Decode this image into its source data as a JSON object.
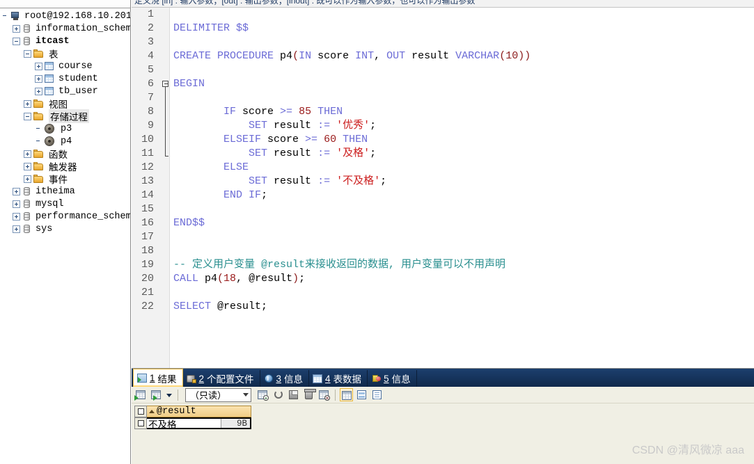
{
  "sidebar": {
    "root_label": "root@192.168.10.201",
    "nodes": [
      {
        "label": "root@192.168.10.201",
        "icon": "server-icon",
        "indent": 0,
        "expander": "none",
        "bold": false,
        "selected": false,
        "cjk": false
      },
      {
        "label": "information_schema",
        "icon": "database-icon",
        "indent": 1,
        "expander": "plus",
        "bold": false,
        "selected": false,
        "cjk": false
      },
      {
        "label": "itcast",
        "icon": "database-icon",
        "indent": 1,
        "expander": "minus",
        "bold": true,
        "selected": false,
        "cjk": false
      },
      {
        "label": "表",
        "icon": "folder-icon",
        "indent": 2,
        "expander": "minus",
        "bold": false,
        "selected": false,
        "cjk": true
      },
      {
        "label": "course",
        "icon": "table-icon",
        "indent": 3,
        "expander": "plus",
        "bold": false,
        "selected": false,
        "cjk": false
      },
      {
        "label": "student",
        "icon": "table-icon",
        "indent": 3,
        "expander": "plus",
        "bold": false,
        "selected": false,
        "cjk": false
      },
      {
        "label": "tb_user",
        "icon": "table-icon",
        "indent": 3,
        "expander": "plus",
        "bold": false,
        "selected": false,
        "cjk": false
      },
      {
        "label": "视图",
        "icon": "folder-icon",
        "indent": 2,
        "expander": "plus",
        "bold": false,
        "selected": false,
        "cjk": true
      },
      {
        "label": "存储过程",
        "icon": "folder-icon",
        "indent": 2,
        "expander": "minus",
        "bold": false,
        "selected": true,
        "cjk": true
      },
      {
        "label": "p3",
        "icon": "procedure-icon",
        "indent": 3,
        "expander": "none",
        "bold": false,
        "selected": false,
        "cjk": false
      },
      {
        "label": "p4",
        "icon": "procedure-icon",
        "indent": 3,
        "expander": "none",
        "bold": false,
        "selected": false,
        "cjk": false
      },
      {
        "label": "函数",
        "icon": "folder-icon",
        "indent": 2,
        "expander": "plus",
        "bold": false,
        "selected": false,
        "cjk": true
      },
      {
        "label": "触发器",
        "icon": "folder-icon",
        "indent": 2,
        "expander": "plus",
        "bold": false,
        "selected": false,
        "cjk": true
      },
      {
        "label": "事件",
        "icon": "folder-icon",
        "indent": 2,
        "expander": "plus",
        "bold": false,
        "selected": false,
        "cjk": true
      },
      {
        "label": "itheima",
        "icon": "database-icon",
        "indent": 1,
        "expander": "plus",
        "bold": false,
        "selected": false,
        "cjk": false
      },
      {
        "label": "mysql",
        "icon": "database-icon",
        "indent": 1,
        "expander": "plus",
        "bold": false,
        "selected": false,
        "cjk": false
      },
      {
        "label": "performance_schema",
        "icon": "database-icon",
        "indent": 1,
        "expander": "plus",
        "bold": false,
        "selected": false,
        "cjk": false
      },
      {
        "label": "sys",
        "icon": "database-icon",
        "indent": 1,
        "expander": "plus",
        "bold": false,
        "selected": false,
        "cjk": false
      }
    ]
  },
  "editor": {
    "clipped_top_text": "定义浇 [in] : 输入参数；[out] : 输出参数；[inout] : 既可以作为输入参数，也可以作为输出参数",
    "lines": [
      {
        "n": 1,
        "indent": 0,
        "tokens": []
      },
      {
        "n": 2,
        "indent": 0,
        "tokens": [
          {
            "t": "kw",
            "s": "DELIMITER"
          },
          {
            "t": "id",
            "s": " "
          },
          {
            "t": "kw",
            "s": "$$"
          }
        ]
      },
      {
        "n": 3,
        "indent": 0,
        "tokens": []
      },
      {
        "n": 4,
        "indent": 0,
        "tokens": [
          {
            "t": "kw",
            "s": "CREATE"
          },
          {
            "t": "id",
            "s": " "
          },
          {
            "t": "kw",
            "s": "PROCEDURE"
          },
          {
            "t": "id",
            "s": " p4"
          },
          {
            "t": "par",
            "s": "("
          },
          {
            "t": "kw",
            "s": "IN"
          },
          {
            "t": "id",
            "s": " score "
          },
          {
            "t": "kw",
            "s": "INT"
          },
          {
            "t": "pun",
            "s": ", "
          },
          {
            "t": "kw",
            "s": "OUT"
          },
          {
            "t": "id",
            "s": " result "
          },
          {
            "t": "kw",
            "s": "VARCHAR"
          },
          {
            "t": "par",
            "s": "(10))"
          }
        ]
      },
      {
        "n": 5,
        "indent": 0,
        "tokens": []
      },
      {
        "n": 6,
        "indent": 0,
        "tokens": [
          {
            "t": "kw",
            "s": "BEGIN"
          }
        ]
      },
      {
        "n": 7,
        "indent": 0,
        "tokens": []
      },
      {
        "n": 8,
        "indent": 0,
        "tokens": [
          {
            "t": "id",
            "s": "        "
          },
          {
            "t": "kw",
            "s": "IF"
          },
          {
            "t": "id",
            "s": " score "
          },
          {
            "t": "kw",
            "s": ">="
          },
          {
            "t": "id",
            "s": " "
          },
          {
            "t": "num",
            "s": "85"
          },
          {
            "t": "id",
            "s": " "
          },
          {
            "t": "kw",
            "s": "THEN"
          }
        ]
      },
      {
        "n": 9,
        "indent": 0,
        "tokens": [
          {
            "t": "id",
            "s": "            "
          },
          {
            "t": "kw",
            "s": "SET"
          },
          {
            "t": "id",
            "s": " result "
          },
          {
            "t": "kw",
            "s": ":="
          },
          {
            "t": "id",
            "s": " "
          },
          {
            "t": "str",
            "s": "'优秀'"
          },
          {
            "t": "pun",
            "s": ";"
          }
        ]
      },
      {
        "n": 10,
        "indent": 0,
        "tokens": [
          {
            "t": "id",
            "s": "        "
          },
          {
            "t": "kw",
            "s": "ELSEIF"
          },
          {
            "t": "id",
            "s": " score "
          },
          {
            "t": "kw",
            "s": ">="
          },
          {
            "t": "id",
            "s": " "
          },
          {
            "t": "num",
            "s": "60"
          },
          {
            "t": "id",
            "s": " "
          },
          {
            "t": "kw",
            "s": "THEN"
          }
        ]
      },
      {
        "n": 11,
        "indent": 0,
        "tokens": [
          {
            "t": "id",
            "s": "            "
          },
          {
            "t": "kw",
            "s": "SET"
          },
          {
            "t": "id",
            "s": " result "
          },
          {
            "t": "kw",
            "s": ":="
          },
          {
            "t": "id",
            "s": " "
          },
          {
            "t": "str",
            "s": "'及格'"
          },
          {
            "t": "pun",
            "s": ";"
          }
        ]
      },
      {
        "n": 12,
        "indent": 0,
        "tokens": [
          {
            "t": "id",
            "s": "        "
          },
          {
            "t": "kw",
            "s": "ELSE"
          }
        ]
      },
      {
        "n": 13,
        "indent": 0,
        "tokens": [
          {
            "t": "id",
            "s": "            "
          },
          {
            "t": "kw",
            "s": "SET"
          },
          {
            "t": "id",
            "s": " result "
          },
          {
            "t": "kw",
            "s": ":="
          },
          {
            "t": "id",
            "s": " "
          },
          {
            "t": "str",
            "s": "'不及格'"
          },
          {
            "t": "pun",
            "s": ";"
          }
        ]
      },
      {
        "n": 14,
        "indent": 0,
        "tokens": [
          {
            "t": "id",
            "s": "        "
          },
          {
            "t": "kw",
            "s": "END"
          },
          {
            "t": "id",
            "s": " "
          },
          {
            "t": "kw",
            "s": "IF"
          },
          {
            "t": "pun",
            "s": ";"
          }
        ]
      },
      {
        "n": 15,
        "indent": 0,
        "tokens": []
      },
      {
        "n": 16,
        "indent": 0,
        "tokens": [
          {
            "t": "kw",
            "s": "END$$"
          }
        ]
      },
      {
        "n": 17,
        "indent": 0,
        "tokens": []
      },
      {
        "n": 18,
        "indent": 0,
        "tokens": []
      },
      {
        "n": 19,
        "indent": 0,
        "tokens": [
          {
            "t": "cmt",
            "s": "-- 定义用户变量 @result来接收返回的数据, 用户变量可以不用声明"
          }
        ]
      },
      {
        "n": 20,
        "indent": 0,
        "tokens": [
          {
            "t": "kw",
            "s": "CALL"
          },
          {
            "t": "id",
            "s": " p4"
          },
          {
            "t": "par",
            "s": "("
          },
          {
            "t": "num",
            "s": "18"
          },
          {
            "t": "pun",
            "s": ", "
          },
          {
            "t": "id",
            "s": "@result"
          },
          {
            "t": "par",
            "s": ")"
          },
          {
            "t": "pun",
            "s": ";"
          }
        ]
      },
      {
        "n": 21,
        "indent": 0,
        "tokens": []
      },
      {
        "n": 22,
        "indent": 0,
        "tokens": [
          {
            "t": "kw",
            "s": "SELECT"
          },
          {
            "t": "id",
            "s": " @result"
          },
          {
            "t": "pun",
            "s": ";"
          }
        ]
      }
    ]
  },
  "bottom": {
    "tabs": [
      {
        "num": "1",
        "label": "结果",
        "icon": "result-grid-icon",
        "active": true
      },
      {
        "num": "2",
        "label": "个配置文件",
        "icon": "profile-icon",
        "active": false
      },
      {
        "num": "3",
        "label": "信息",
        "icon": "info-icon",
        "active": false
      },
      {
        "num": "4",
        "label": "表数据",
        "icon": "table-data-icon",
        "active": false
      },
      {
        "num": "5",
        "label": "信息",
        "icon": "message-icon",
        "active": false
      }
    ],
    "toolbar": {
      "mode_value": "（只读）",
      "buttons": [
        {
          "name": "grid-view-button",
          "icon": "grid-icon"
        },
        {
          "name": "grid-export-button",
          "icon": "grid-export-icon"
        },
        {
          "name": "view-dropdown-button",
          "icon": "chevron-down-icon"
        },
        {
          "name": "add-record-button",
          "icon": "add-record-icon"
        },
        {
          "name": "duplicate-record-button",
          "icon": "duplicate-record-icon"
        },
        {
          "name": "save-record-button",
          "icon": "floppy-disk-icon"
        },
        {
          "name": "delete-record-button",
          "icon": "trash-icon"
        },
        {
          "name": "refresh-button",
          "icon": "refresh-icon"
        },
        {
          "name": "grid-layout-button",
          "icon": "grid-layout-icon"
        },
        {
          "name": "form-layout-button",
          "icon": "form-layout-icon"
        },
        {
          "name": "text-layout-button",
          "icon": "text-layout-icon"
        }
      ]
    },
    "grid": {
      "columns": [
        "@result"
      ],
      "rows": [
        {
          "value": "不及格",
          "size": "9B"
        }
      ]
    }
  },
  "watermark": "CSDN @清风微凉 aaa",
  "colors": {
    "keyword": "#6b6bd6",
    "string": "#cc2020",
    "comment": "#2a8f8f",
    "number": "#9a1a1a",
    "paren": "#8b1a1a",
    "tabbar_bg": "#15335a",
    "active_tab_border": "#e8b73a",
    "panel_bg": "#f0efe4"
  }
}
